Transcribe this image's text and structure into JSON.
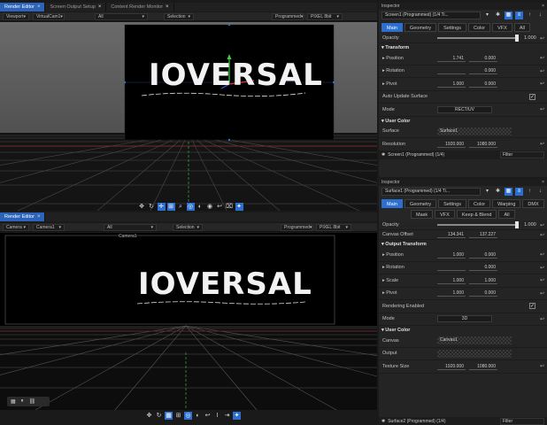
{
  "top_tabs": [
    {
      "label": "Render Editor",
      "active": true
    },
    {
      "label": "Screen Output Setup",
      "active": false
    },
    {
      "label": "Content Render Monitor",
      "active": false
    }
  ],
  "viewport1": {
    "toolbar": {
      "view": "Viewport",
      "camera": "VirtualCam1",
      "select": "Selection",
      "preset": "Programmed",
      "mode": "PIXEL 8bit"
    },
    "logo": "IOVERSAL",
    "tool_icons": [
      "pan-icon",
      "orbit-icon",
      "move-icon",
      "transform-icon",
      "zoom-icon",
      "target-icon",
      "lock-icon",
      "camera-icon",
      "undo-icon",
      "redo-icon",
      "gizmo-icon"
    ]
  },
  "viewport2": {
    "tab": "Render Editor",
    "toolbar": {
      "view": "Camera",
      "camera": "Camera1",
      "select": "Selection",
      "preset": "Programmed",
      "mode": "PIXEL 8bit"
    },
    "label": "Camera1",
    "logo": "IOVERSAL"
  },
  "inspector1": {
    "title": "Inspector",
    "object": "Screen1 (Programmed) (1/4 Ti...",
    "tabs": [
      {
        "label": "Main",
        "active": true
      },
      {
        "label": "Geometry",
        "active": false
      },
      {
        "label": "Settings",
        "active": false
      },
      {
        "label": "Color",
        "active": false
      },
      {
        "label": "VFX",
        "active": false
      },
      {
        "label": "All",
        "active": false
      }
    ],
    "opacity_label": "Opacity",
    "opacity_value": "1.000",
    "transform_label": "Transform",
    "rows": [
      {
        "label": "Position",
        "v1": "1.741",
        "v2": "0.000"
      },
      {
        "label": "Rotation",
        "v1": "",
        "v2": "0.000"
      },
      {
        "label": "Pivot",
        "v1": "1.000",
        "v2": "0.000"
      }
    ],
    "auto_update": "Auto Update Surface",
    "mode_label": "Mode",
    "mode_value": "RECT/UV",
    "color_label": "User Color",
    "surface_label": "Surface",
    "surface_value": "Surface1",
    "resolution_label": "Resolution",
    "res1": "1920.000",
    "res2": "1080.000",
    "footer": "Screen1 (Programmed) (1/4)",
    "footer_filter": "Filter"
  },
  "inspector2": {
    "title": "Inspector",
    "object": "Surface1 (Programmed) (1/4 Ti...",
    "tabs": [
      {
        "label": "Main",
        "active": true
      },
      {
        "label": "Geometry",
        "active": false
      },
      {
        "label": "Settings",
        "active": false
      },
      {
        "label": "Color",
        "active": false
      },
      {
        "label": "Warping",
        "active": false
      },
      {
        "label": "DMX",
        "active": false
      },
      {
        "label": "Mask",
        "active": false
      },
      {
        "label": "VFX",
        "active": false
      },
      {
        "label": "Keep & Blend",
        "active": false
      },
      {
        "label": "All",
        "active": false
      }
    ],
    "opacity_label": "Opacity",
    "opacity_value": "1.000",
    "canvas_offset_label": "Canvas Offset",
    "co1": "134.341",
    "co2": "137.227",
    "output_transform": "Output Transform",
    "rows": [
      {
        "label": "Position",
        "v1": "1.000",
        "v2": "0.000"
      },
      {
        "label": "Rotation",
        "v1": "",
        "v2": "0.000"
      },
      {
        "label": "Scale",
        "v1": "1.000",
        "v2": "1.000"
      },
      {
        "label": "Pivot",
        "v1": "1.000",
        "v2": "0.000"
      }
    ],
    "rendering_enabled": "Rendering Enabled",
    "mode_label": "Mode",
    "mode_value": "3D",
    "color_label": "User Color",
    "canvas_label": "Canvas",
    "canvas_value": "Canvas1",
    "output_label": "Output",
    "texture_label": "Texture Size",
    "tex1": "1920.000",
    "tex2": "1080.000",
    "footer": "Surface2 (Programmed) (1/4)",
    "footer_filter": "Filter"
  },
  "colors": {
    "accent": "#2b6fd0",
    "bg": "#1a1a1a",
    "panel": "#242424"
  }
}
